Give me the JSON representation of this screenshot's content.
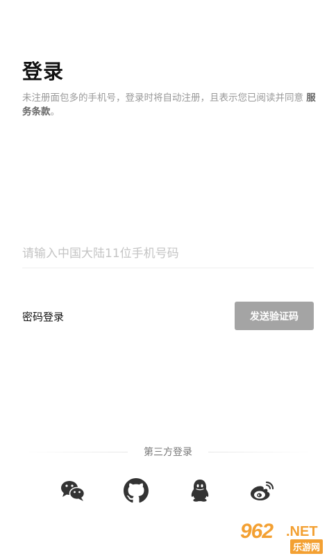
{
  "header": {
    "title": "登录",
    "notice_text": "未注册面包多的手机号，登录时将自动注册，且表示您已阅读并同意 ",
    "terms_link": "服务条款",
    "notice_end": "。"
  },
  "form": {
    "phone_placeholder": "请输入中国大陆11位手机号码",
    "phone_value": "",
    "password_login_label": "密码登录",
    "send_code_label": "发送验证码"
  },
  "third_party": {
    "label": "第三方登录",
    "providers": [
      {
        "name": "wechat",
        "icon": "wechat-icon"
      },
      {
        "name": "github",
        "icon": "github-icon"
      },
      {
        "name": "qq",
        "icon": "qq-icon"
      },
      {
        "name": "weibo",
        "icon": "weibo-icon"
      }
    ]
  },
  "watermark": {
    "number": "962",
    "suffix": ".NET",
    "site": "乐游网"
  },
  "colors": {
    "button_bg": "#a4a4a4",
    "icon": "#333333",
    "watermark": "#f3a032"
  }
}
